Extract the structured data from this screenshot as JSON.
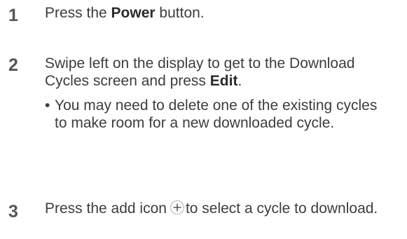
{
  "steps": [
    {
      "number": "1",
      "text_before": "Press the ",
      "bold": "Power",
      "text_after": " button."
    },
    {
      "number": "2",
      "line1": "Swipe left on the display to get to the Download",
      "line2_before": "Cycles screen and press ",
      "bold": "Edit",
      "line2_after": ".",
      "note": {
        "bullet": "•",
        "text": "You may need to delete one of the existing cycles to make room for a new downloaded cycle."
      }
    },
    {
      "number": "3",
      "text_before": "Press the add icon",
      "icon": "add-icon",
      "text_after": "to select a cycle to download."
    }
  ],
  "colors": {
    "text": "#3d3d3d",
    "number": "#555555",
    "icon_stroke": "#555555"
  }
}
